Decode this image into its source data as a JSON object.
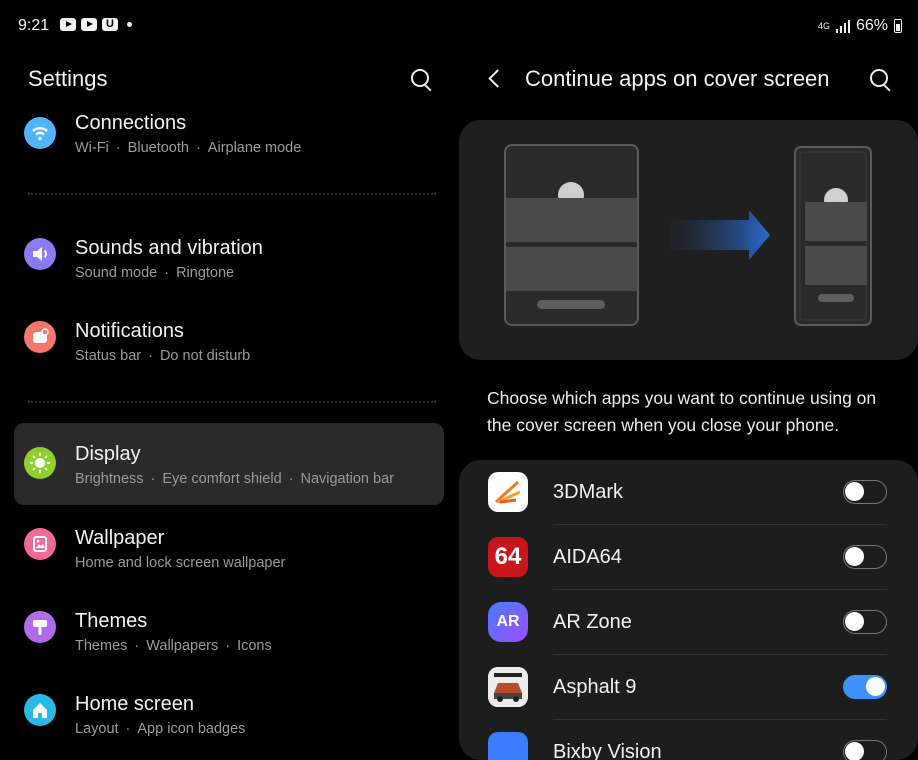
{
  "status_bar": {
    "time": "9:21",
    "network": "4G",
    "battery": "66%",
    "notification_icons": [
      "youtube-icon",
      "youtube-icon",
      "u-app-icon"
    ]
  },
  "left_pane": {
    "title": "Settings",
    "items": [
      {
        "title": "Connections",
        "subs": [
          "Wi-Fi",
          "Bluetooth",
          "Airplane mode"
        ],
        "icon": "wifi-icon",
        "color": "#4fb3ff"
      },
      {
        "title": "Sounds and vibration",
        "subs": [
          "Sound mode",
          "Ringtone"
        ],
        "icon": "speaker-icon",
        "color": "#8a7cf0"
      },
      {
        "title": "Notifications",
        "subs": [
          "Status bar",
          "Do not disturb"
        ],
        "icon": "bell-icon",
        "color": "#f2766a"
      },
      {
        "title": "Display",
        "subs": [
          "Brightness",
          "Eye comfort shield",
          "Navigation bar"
        ],
        "icon": "sun-icon",
        "color": "#8fcf2f",
        "selected": true
      },
      {
        "title": "Wallpaper",
        "subs": [
          "Home and lock screen wallpaper"
        ],
        "icon": "image-icon",
        "color": "#f06a9a"
      },
      {
        "title": "Themes",
        "subs": [
          "Themes",
          "Wallpapers",
          "Icons"
        ],
        "icon": "brush-icon",
        "color": "#b36bea"
      },
      {
        "title": "Home screen",
        "subs": [
          "Layout",
          "App icon badges"
        ],
        "icon": "home-icon",
        "color": "#2ab8e6"
      }
    ]
  },
  "right_pane": {
    "title": "Continue apps on cover screen",
    "description": "Choose which apps you want to continue using on the cover screen when you close your phone.",
    "apps": [
      {
        "name": "3DMark",
        "enabled": false,
        "icon": "3dmark-icon"
      },
      {
        "name": "AIDA64",
        "enabled": false,
        "icon": "aida64-icon",
        "icon_text": "64"
      },
      {
        "name": "AR Zone",
        "enabled": false,
        "icon": "ar-zone-icon",
        "icon_text": "AR"
      },
      {
        "name": "Asphalt 9",
        "enabled": true,
        "icon": "asphalt-icon"
      },
      {
        "name": "Bixby Vision",
        "enabled": false,
        "icon": "bixby-icon"
      }
    ]
  },
  "colors": {
    "toggle_on": "#3e91ff",
    "selected_bg": "#2a2a2a"
  }
}
